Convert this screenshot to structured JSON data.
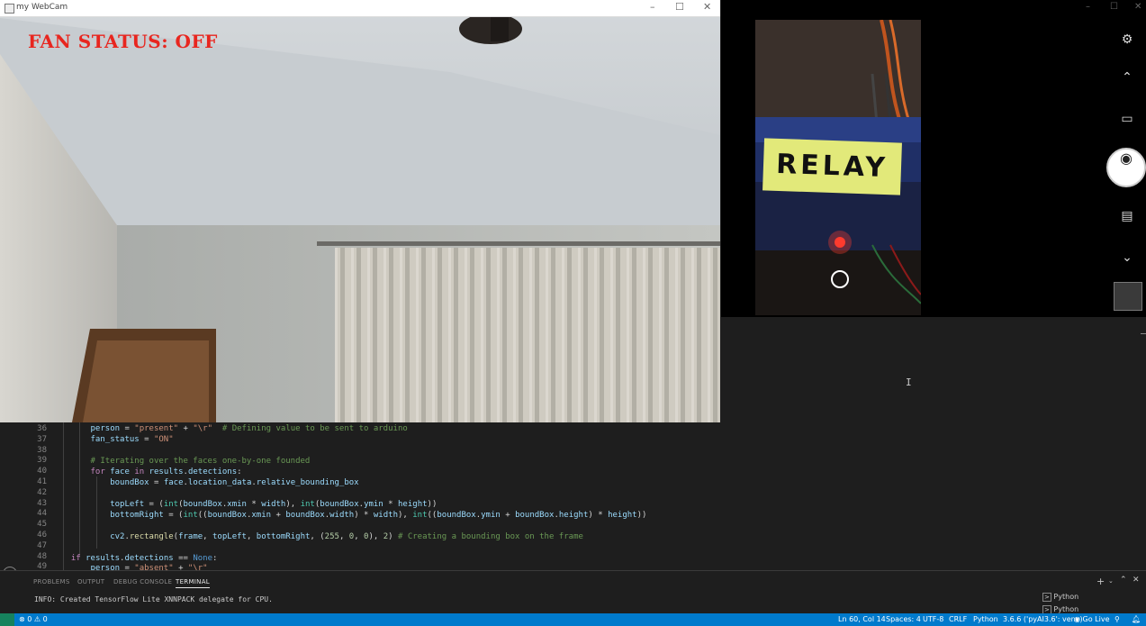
{
  "webcam": {
    "title": "my WebCam",
    "overlay_text": "FAN STATUS: OFF",
    "overlay_color": "#e8261f"
  },
  "camera": {
    "sticker_text": "RELAY",
    "icons": [
      "camera-settings-icon",
      "chevron-up-icon",
      "video-mode-icon",
      "photo-capture-icon",
      "document-scan-icon",
      "chevron-down-icon",
      "gallery-thumbnail"
    ]
  },
  "editor": {
    "lines": [
      {
        "n": "36"
      },
      {
        "n": "37"
      },
      {
        "n": "38"
      },
      {
        "n": "39"
      },
      {
        "n": "40"
      },
      {
        "n": "41"
      },
      {
        "n": "42"
      },
      {
        "n": "43"
      },
      {
        "n": "44"
      },
      {
        "n": "45"
      },
      {
        "n": "46"
      },
      {
        "n": "47"
      },
      {
        "n": "48"
      },
      {
        "n": "49"
      }
    ]
  },
  "panel": {
    "tabs": [
      "PROBLEMS",
      "OUTPUT",
      "DEBUG CONSOLE",
      "TERMINAL"
    ],
    "active_tab": "TERMINAL",
    "terminal_line": "INFO: Created TensorFlow Lite XNNPACK delegate for CPU.",
    "terminals": [
      "Python",
      "Python"
    ]
  },
  "statusbar": {
    "errors": "0",
    "warnings": "0",
    "position": "Ln 60, Col 14",
    "spaces": "Spaces: 4",
    "encoding": "UTF-8",
    "eol": "CRLF",
    "language": "Python",
    "interpreter": "3.6.6 ('pyAI3.6': venv)",
    "golive": "Go Live",
    "accent": "#007acc"
  }
}
